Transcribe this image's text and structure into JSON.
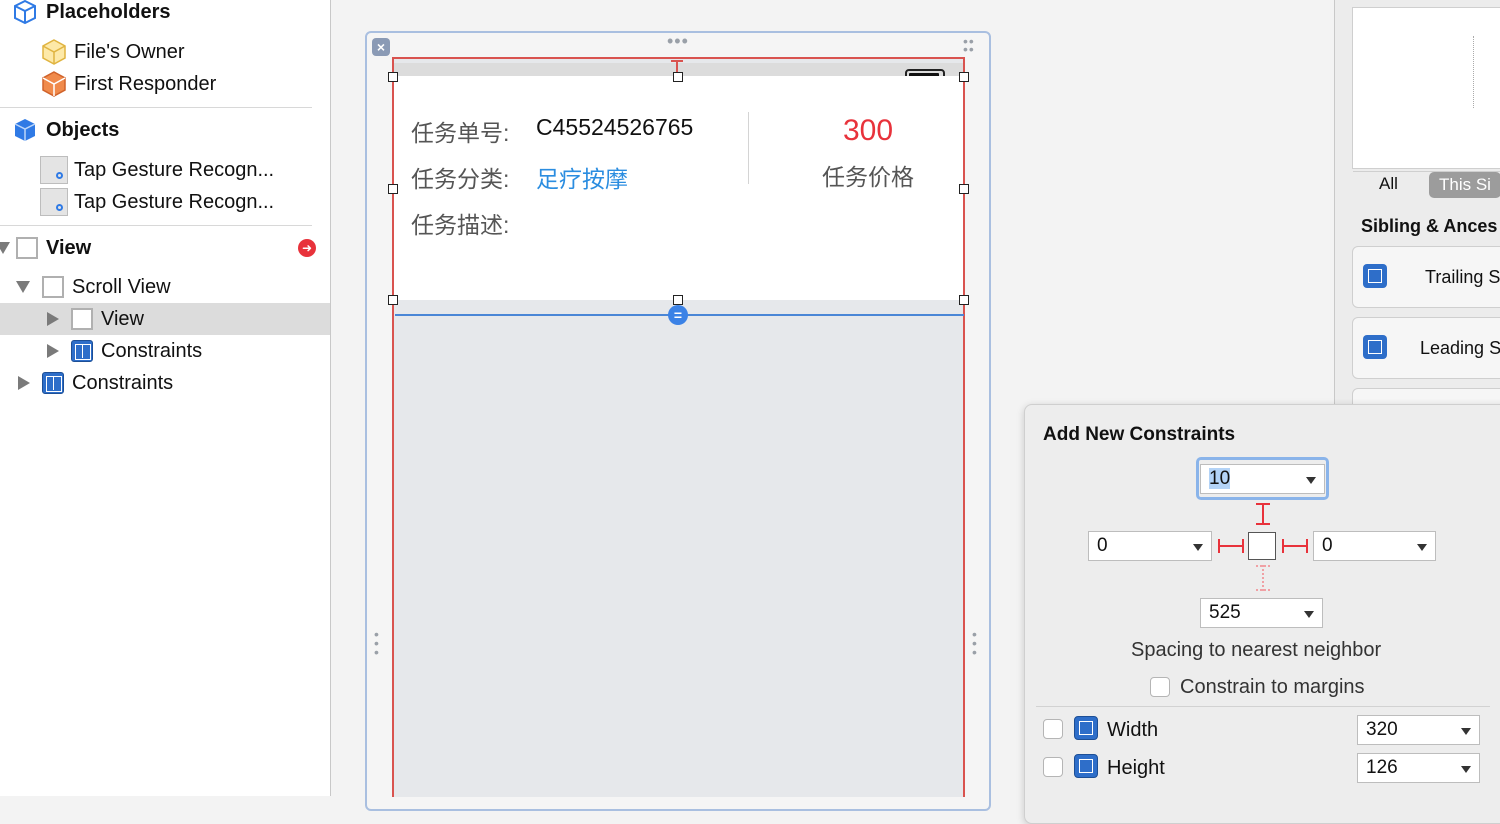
{
  "outline": {
    "placeholders_label": "Placeholders",
    "files_owner": "File's Owner",
    "first_responder": "First Responder",
    "objects_label": "Objects",
    "tap_gesture_1": "Tap Gesture Recogn...",
    "tap_gesture_2": "Tap Gesture Recogn...",
    "view_label": "View",
    "scroll_view_label": "Scroll View",
    "inner_view_label": "View",
    "inner_constraints_label": "Constraints",
    "constraints_label": "Constraints"
  },
  "card": {
    "task_number_label": "任务单号:",
    "task_number_value": "C45524526765",
    "task_category_label": "任务分类:",
    "task_category_value": "足疗按摩",
    "task_description_label": "任务描述:",
    "price_value": "300",
    "price_label": "任务价格"
  },
  "inspector": {
    "filter_all": "All",
    "filter_this": "This Si",
    "section_title": "Sibling & Ances",
    "trailing_label": "Trailing S",
    "leading_label": "Leading S"
  },
  "popover": {
    "title": "Add New Constraints",
    "top_value": "10",
    "left_value": "0",
    "right_value": "0",
    "bottom_value": "525",
    "spacing_caption": "Spacing to nearest neighbor",
    "constrain_margins_label": "Constrain to margins",
    "width_label": "Width",
    "width_value": "320",
    "height_label": "Height",
    "height_value": "126"
  },
  "colors": {
    "price_red": "#e8323b",
    "link_blue": "#2b8de0",
    "constraint_red": "#e8323b",
    "selection_blue": "#3b82e6"
  }
}
